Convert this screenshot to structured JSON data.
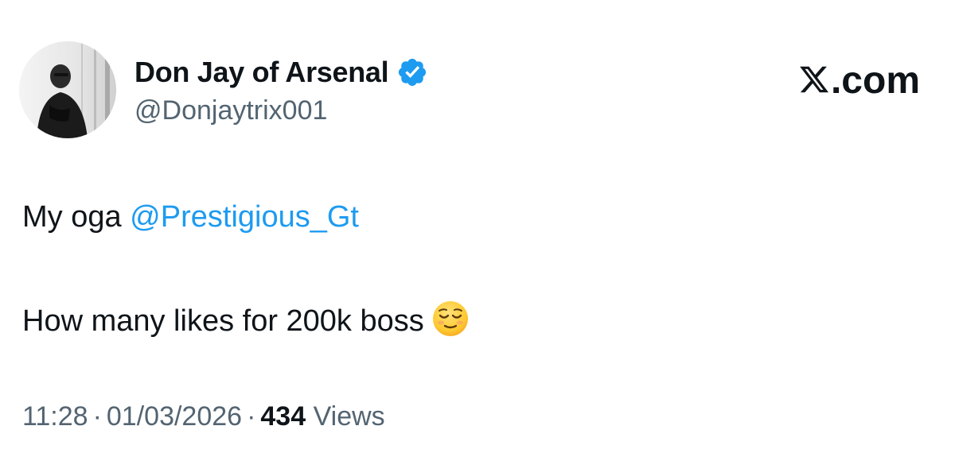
{
  "author": {
    "name": "Don Jay of Arsenal",
    "handle": "@Donjaytrix001",
    "verified": true,
    "verified_color": "#1d9bf0",
    "avatar_icon": "profile-photo"
  },
  "brand": {
    "logo_icon": "x-logo-icon",
    "logo_text": ".com"
  },
  "tweet": {
    "line1_prefix": "My oga ",
    "mention": "@Prestigious_Gt",
    "line2_text": "How many likes for 200k boss",
    "emoji_icon": "relieved-face-emoji"
  },
  "meta": {
    "time": "11:28",
    "date": "01/03/2026",
    "separator": "·",
    "views_count": "434",
    "views_label": "Views"
  },
  "colors": {
    "text_primary": "#0f1419",
    "text_secondary": "#536471",
    "link": "#1d9bf0",
    "background": "#ffffff"
  }
}
